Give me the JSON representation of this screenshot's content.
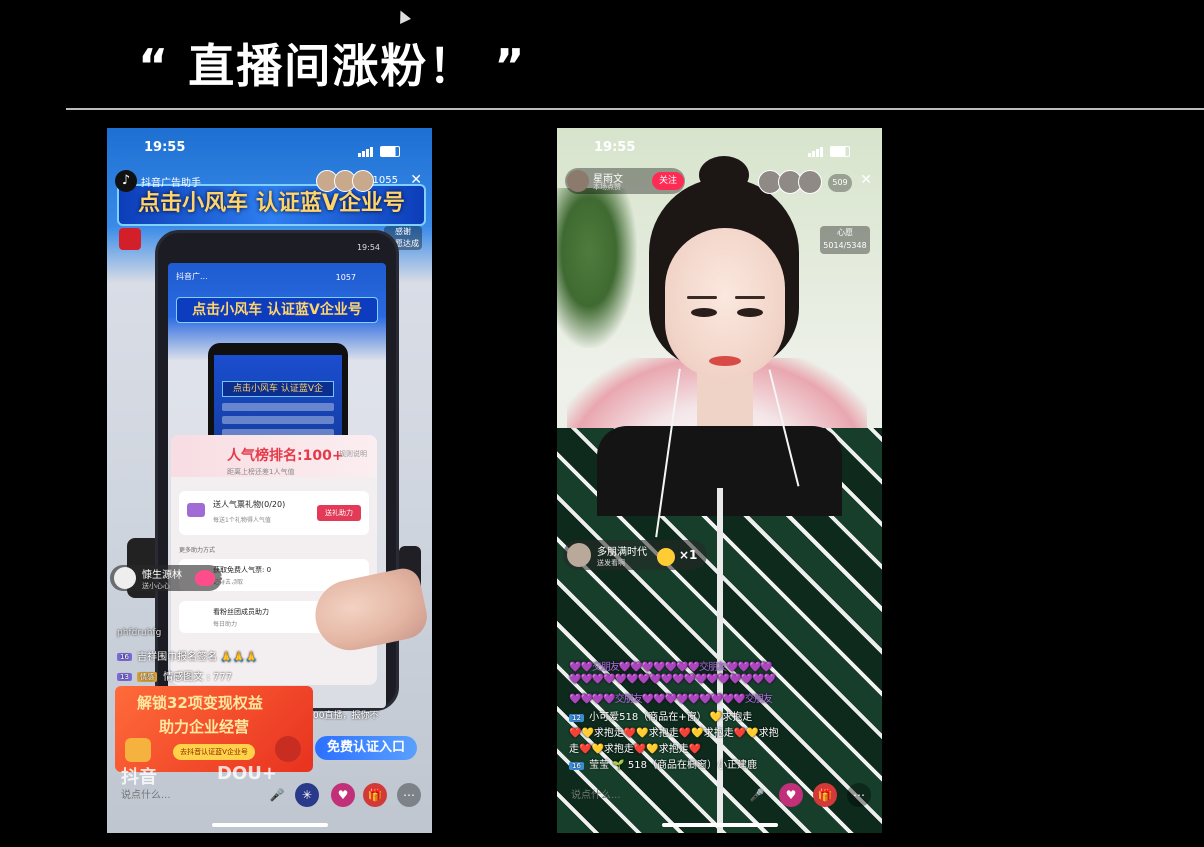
{
  "slide": {
    "title": "“ 直播间涨粉！ ”"
  },
  "left_phone": {
    "status_time": "19:55",
    "host_name": "抖音广告助手",
    "viewer_count": "1055",
    "banner_text": "点击小风车 认证蓝V企业号",
    "rank_tag_top": "感谢",
    "rank_tag_bottom": "心愿达成",
    "inner_status": "19:54",
    "inner_host": "抖音广...",
    "inner_count": "1057",
    "inner_banner": "点击小风车 认证蓝V企业号",
    "inner_mini_banner": "点击小风车 认证蓝V企",
    "popup": {
      "rank": "人气榜排名:100+",
      "rank_tip": "距离上榜还差1人气值",
      "rule": "规则说明",
      "task_title": "送人气票礼物(0/20)",
      "task_sub": "每送1个礼物得人气值",
      "task_button": "送礼助力",
      "more": "更多助力方式",
      "row1_title": "获取免费人气票: 0",
      "row1_sub": "记得去领取",
      "row2_title": "看粉丝团成员助力",
      "row2_sub": "每日助力"
    },
    "comment_name": "慷生源林",
    "comment_sub": "送小心心",
    "comment_count": "×1",
    "watermark_text": "phfdruhfg",
    "chat": [
      {
        "level": "16",
        "badge": "",
        "text": "吉祥围巾报名签名 🙏🙏🙏"
      },
      {
        "level": "13",
        "badge": "情感",
        "text": "情感图文 : 777"
      }
    ],
    "promo_line1": "解锁32项变现权益",
    "promo_line2": "助力企业经营",
    "promo_button": "去抖音认证蓝V企业号",
    "cta_label": "免费认证入口",
    "behind_text": "00直播，报你不",
    "say_placeholder": "说点什么...",
    "watermark_brand": "抖音",
    "watermark_id": "DOU+"
  },
  "right_phone": {
    "status_time": "19:55",
    "host_name": "星雨文",
    "host_sub": "本场点赞",
    "follow_label": "关注",
    "viewer_count": "509",
    "heart_label": "心愿",
    "heart_value": "5014/5348",
    "gift_user": "多朋满时代",
    "gift_sub": "送发看啊",
    "gift_count": "×1",
    "chat": [
      {
        "level": "",
        "text": "💜💜交朋友💜💜💜💜💜💜💜交朋友💜💜💜💜"
      },
      {
        "level": "",
        "text": "💜💜💜💜💜💜💜💜💜💜💜💜💜💜💜💜💜💜"
      },
      {
        "level": "",
        "text": "💜💜💜💜交朋友💜💜💜💜💜💜💜💜💜交朋友"
      },
      {
        "level": "12",
        "text": "小可爱518（商品在+窗）  💛求抱走"
      },
      {
        "level": "",
        "text": "❤️💛求抱走❤️💛求抱走❤️💛求抱走❤️💛求抱"
      },
      {
        "level": "",
        "text": "走❤️💛求抱走❤️💛求抱走❤️"
      },
      {
        "level": "16",
        "text": "莹莹 🌱 518（商品在橱窗）小正建鹿"
      }
    ],
    "say_placeholder": "说点什么..."
  },
  "icons": {
    "mic": "mic-icon",
    "pinwheel": "pinwheel-icon",
    "heart": "heart-icon",
    "gift": "gift-icon",
    "more": "more-icon"
  },
  "colors": {
    "background": "#000000",
    "rule": "#bdbdbd",
    "banner_blue": "#1d6fd2",
    "follow_red": "#fe2c55",
    "cta_blue": "#2b70ff",
    "promo_orange": "#e8321f"
  }
}
